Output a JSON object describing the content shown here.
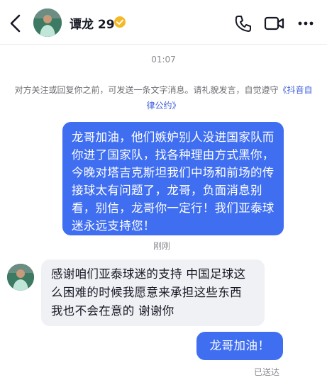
{
  "header": {
    "title": "谭龙 29",
    "icons": {
      "back": "back-arrow-icon",
      "verified": "verified-badge-icon",
      "phone": "phone-icon",
      "video": "video-call-icon",
      "more": "more-icon"
    }
  },
  "conversation": {
    "timestamp": "01:07",
    "notice_text": "对方关注或回复你之前，可发送一条文字消息。请礼貌发言，自觉遵守",
    "notice_link": "《抖音自律公约》",
    "messages": [
      {
        "direction": "outgoing",
        "text": "龙哥加油，他们嫉妒别人没进国家队而你进了国家队，找各种理由方式黑你，今晚对塔吉克斯坦我们中场和前场的传接球太有问题了，龙哥，负面消息别看，别信，龙哥你一定行！我们亚泰球迷永远支持您！",
        "status": "刚刚"
      },
      {
        "direction": "incoming",
        "text": "感谢咱们亚泰球迷的支持 中国足球这么困难的时候我愿意来承担这些东西 我也不会在意的 谢谢你"
      },
      {
        "direction": "outgoing",
        "text": "龙哥加油！",
        "status": "已送达"
      }
    ]
  },
  "colors": {
    "outgoing_bubble": "#3f6ef0",
    "incoming_bubble": "#f0f1f5",
    "link": "#3b5bdb",
    "verified": "#f5b826"
  }
}
